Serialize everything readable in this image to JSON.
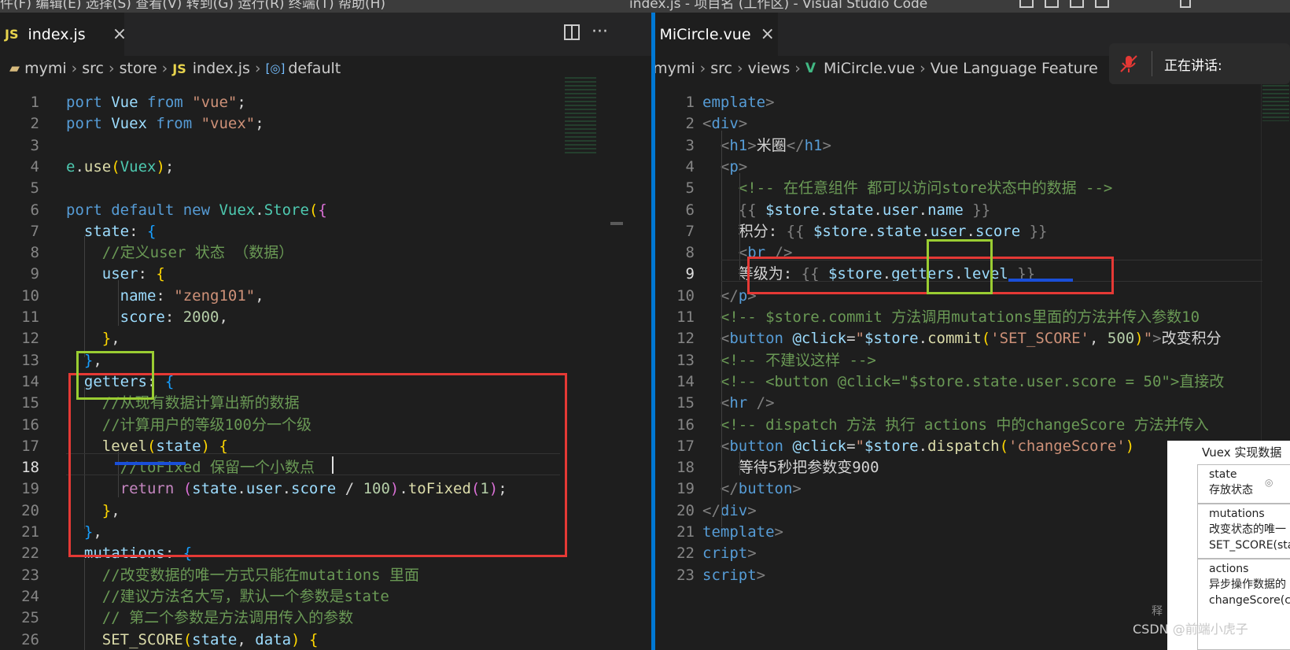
{
  "window": {
    "menu_text": "件(F)   编辑(E)   选择(S)   查看(V)   转到(G)   运行(R)   终端(T)   帮助(H)",
    "title": "index.js - 项目名 (工作区) - Visual Studio Code"
  },
  "left": {
    "tab_label": "index.js",
    "tab_icon": "JS",
    "breadcrumb": [
      "mymi",
      "src",
      "store",
      "index.js",
      "default"
    ],
    "current_line": 18,
    "lines": [
      {
        "n": 1,
        "segs": [
          [
            "kw",
            "port "
          ],
          [
            "var",
            "Vue "
          ],
          [
            "kw",
            "from "
          ],
          [
            "str",
            "\"vue\""
          ],
          [
            "txt",
            ";"
          ]
        ]
      },
      {
        "n": 2,
        "segs": [
          [
            "kw",
            "port "
          ],
          [
            "var",
            "Vuex "
          ],
          [
            "kw",
            "from "
          ],
          [
            "str",
            "\"vuex\""
          ],
          [
            "txt",
            ";"
          ]
        ]
      },
      {
        "n": 3,
        "segs": []
      },
      {
        "n": 4,
        "segs": [
          [
            "cls",
            "e"
          ],
          [
            "txt",
            "."
          ],
          [
            "fn",
            "use"
          ],
          [
            "b1",
            "("
          ],
          [
            "cls",
            "Vuex"
          ],
          [
            "b1",
            ")"
          ],
          [
            "txt",
            ";"
          ]
        ]
      },
      {
        "n": 5,
        "segs": []
      },
      {
        "n": 6,
        "segs": [
          [
            "kw",
            "port "
          ],
          [
            "kw",
            "default "
          ],
          [
            "kw",
            "new "
          ],
          [
            "cls",
            "Vuex"
          ],
          [
            "txt",
            "."
          ],
          [
            "cls",
            "Store"
          ],
          [
            "b1",
            "("
          ],
          [
            "b2",
            "{"
          ]
        ]
      },
      {
        "n": 7,
        "segs": [
          [
            "txt",
            "  "
          ],
          [
            "var",
            "state"
          ],
          [
            "txt",
            ": "
          ],
          [
            "b3",
            "{"
          ]
        ]
      },
      {
        "n": 8,
        "segs": [
          [
            "txt",
            "    "
          ],
          [
            "cmt",
            "//定义user 状态 （数据）"
          ]
        ]
      },
      {
        "n": 9,
        "segs": [
          [
            "txt",
            "    "
          ],
          [
            "var",
            "user"
          ],
          [
            "txt",
            ": "
          ],
          [
            "b1",
            "{"
          ]
        ]
      },
      {
        "n": 10,
        "segs": [
          [
            "txt",
            "      "
          ],
          [
            "var",
            "name"
          ],
          [
            "txt",
            ": "
          ],
          [
            "str",
            "\"zeng101\""
          ],
          [
            "txt",
            ","
          ]
        ]
      },
      {
        "n": 11,
        "segs": [
          [
            "txt",
            "      "
          ],
          [
            "var",
            "score"
          ],
          [
            "txt",
            ": "
          ],
          [
            "num",
            "2000"
          ],
          [
            "txt",
            ","
          ]
        ]
      },
      {
        "n": 12,
        "segs": [
          [
            "txt",
            "    "
          ],
          [
            "b1",
            "}"
          ],
          [
            "txt",
            ","
          ]
        ]
      },
      {
        "n": 13,
        "segs": [
          [
            "txt",
            "  "
          ],
          [
            "b3",
            "}"
          ],
          [
            "txt",
            ","
          ]
        ]
      },
      {
        "n": 14,
        "segs": [
          [
            "txt",
            "  "
          ],
          [
            "var",
            "getters"
          ],
          [
            "txt",
            ": "
          ],
          [
            "b3",
            "{"
          ]
        ]
      },
      {
        "n": 15,
        "segs": [
          [
            "txt",
            "    "
          ],
          [
            "cmt",
            "//从现有数据计算出新的数据"
          ]
        ]
      },
      {
        "n": 16,
        "segs": [
          [
            "txt",
            "    "
          ],
          [
            "cmt",
            "//计算用户的等级100分一个级"
          ]
        ]
      },
      {
        "n": 17,
        "segs": [
          [
            "txt",
            "    "
          ],
          [
            "fn",
            "level"
          ],
          [
            "b1",
            "("
          ],
          [
            "var",
            "state"
          ],
          [
            "b1",
            ")"
          ],
          [
            "txt",
            " "
          ],
          [
            "b1",
            "{"
          ]
        ]
      },
      {
        "n": 18,
        "segs": [
          [
            "txt",
            "      "
          ],
          [
            "cmt",
            "//toFixed 保留一个小数点"
          ]
        ]
      },
      {
        "n": 19,
        "segs": [
          [
            "txt",
            "      "
          ],
          [
            "ctl",
            "return "
          ],
          [
            "b2",
            "("
          ],
          [
            "var",
            "state"
          ],
          [
            "txt",
            "."
          ],
          [
            "var",
            "user"
          ],
          [
            "txt",
            "."
          ],
          [
            "var",
            "score"
          ],
          [
            "txt",
            " / "
          ],
          [
            "num",
            "100"
          ],
          [
            "b2",
            ")"
          ],
          [
            "txt",
            "."
          ],
          [
            "fn",
            "toFixed"
          ],
          [
            "b2",
            "("
          ],
          [
            "num",
            "1"
          ],
          [
            "b2",
            ")"
          ],
          [
            "txt",
            ";"
          ]
        ]
      },
      {
        "n": 20,
        "segs": [
          [
            "txt",
            "    "
          ],
          [
            "b1",
            "}"
          ],
          [
            "txt",
            ","
          ]
        ]
      },
      {
        "n": 21,
        "segs": [
          [
            "txt",
            "  "
          ],
          [
            "b3",
            "}"
          ],
          [
            "txt",
            ","
          ]
        ]
      },
      {
        "n": 22,
        "segs": [
          [
            "txt",
            "  "
          ],
          [
            "var",
            "mutations"
          ],
          [
            "txt",
            ": "
          ],
          [
            "b3",
            "{"
          ]
        ]
      },
      {
        "n": 23,
        "segs": [
          [
            "txt",
            "    "
          ],
          [
            "cmt",
            "//改变数据的唯一方式只能在mutations 里面"
          ]
        ]
      },
      {
        "n": 24,
        "segs": [
          [
            "txt",
            "    "
          ],
          [
            "cmt",
            "//建议方法名大写，默认一个参数是state"
          ]
        ]
      },
      {
        "n": 25,
        "segs": [
          [
            "txt",
            "    "
          ],
          [
            "cmt",
            "// 第二个参数是方法调用传入的参数"
          ]
        ]
      },
      {
        "n": 26,
        "segs": [
          [
            "txt",
            "    "
          ],
          [
            "fn",
            "SET_SCORE"
          ],
          [
            "b1",
            "("
          ],
          [
            "var",
            "state"
          ],
          [
            "txt",
            ", "
          ],
          [
            "var",
            "data"
          ],
          [
            "b1",
            ")"
          ],
          [
            "txt",
            " "
          ],
          [
            "b1",
            "{"
          ]
        ]
      }
    ]
  },
  "right": {
    "tab_label": "MiCircle.vue",
    "tab_icon": "V",
    "breadcrumb": [
      "mymi",
      "src",
      "views",
      "MiCircle.vue",
      "Vue Language Feature"
    ],
    "lines": [
      {
        "n": 1,
        "segs": [
          [
            "tag",
            "emplate"
          ],
          [
            "punc",
            ">"
          ]
        ]
      },
      {
        "n": 2,
        "segs": [
          [
            "punc",
            "<"
          ],
          [
            "tag",
            "div"
          ],
          [
            "punc",
            ">"
          ]
        ]
      },
      {
        "n": 3,
        "segs": [
          [
            "txt",
            "  "
          ],
          [
            "punc",
            "<"
          ],
          [
            "tag",
            "h1"
          ],
          [
            "punc",
            ">"
          ],
          [
            "txt",
            "米圈"
          ],
          [
            "punc",
            "</"
          ],
          [
            "tag",
            "h1"
          ],
          [
            "punc",
            ">"
          ]
        ]
      },
      {
        "n": 4,
        "segs": [
          [
            "txt",
            "  "
          ],
          [
            "punc",
            "<"
          ],
          [
            "tag",
            "p"
          ],
          [
            "punc",
            ">"
          ]
        ]
      },
      {
        "n": 5,
        "segs": [
          [
            "txt",
            "    "
          ],
          [
            "cmt",
            "<!-- 在任意组件 都可以访问store状态中的数据 -->"
          ]
        ]
      },
      {
        "n": 6,
        "segs": [
          [
            "txt",
            "    "
          ],
          [
            "punc",
            "{{ "
          ],
          [
            "var",
            "$store"
          ],
          [
            "txt",
            "."
          ],
          [
            "var",
            "state"
          ],
          [
            "txt",
            "."
          ],
          [
            "var",
            "user"
          ],
          [
            "txt",
            "."
          ],
          [
            "var",
            "name"
          ],
          [
            "punc",
            " }}"
          ]
        ]
      },
      {
        "n": 7,
        "segs": [
          [
            "txt",
            "    积分: "
          ],
          [
            "punc",
            "{{ "
          ],
          [
            "var",
            "$store"
          ],
          [
            "txt",
            "."
          ],
          [
            "var",
            "state"
          ],
          [
            "txt",
            "."
          ],
          [
            "var",
            "user"
          ],
          [
            "txt",
            "."
          ],
          [
            "var",
            "score"
          ],
          [
            "punc",
            " }}"
          ]
        ]
      },
      {
        "n": 8,
        "segs": [
          [
            "txt",
            "    "
          ],
          [
            "punc",
            "<"
          ],
          [
            "tag",
            "br"
          ],
          [
            "punc",
            " />"
          ]
        ]
      },
      {
        "n": 9,
        "segs": [
          [
            "txt",
            "    等级为: "
          ],
          [
            "punc",
            "{{ "
          ],
          [
            "var",
            "$store"
          ],
          [
            "txt",
            "."
          ],
          [
            "var",
            "getters"
          ],
          [
            "txt",
            "."
          ],
          [
            "var",
            "level"
          ],
          [
            "punc",
            " }}"
          ]
        ]
      },
      {
        "n": 10,
        "segs": [
          [
            "txt",
            "  "
          ],
          [
            "punc",
            "</"
          ],
          [
            "tag",
            "p"
          ],
          [
            "punc",
            ">"
          ]
        ]
      },
      {
        "n": 11,
        "segs": [
          [
            "txt",
            "  "
          ],
          [
            "cmt",
            "<!-- $store.commit 方法调用mutations里面的方法并传入参数10"
          ]
        ]
      },
      {
        "n": 12,
        "segs": [
          [
            "txt",
            "  "
          ],
          [
            "punc",
            "<"
          ],
          [
            "tag",
            "button"
          ],
          [
            "txt",
            " "
          ],
          [
            "var",
            "@click"
          ],
          [
            "txt",
            "="
          ],
          [
            "str",
            "\""
          ],
          [
            "var",
            "$store"
          ],
          [
            "txt",
            "."
          ],
          [
            "fn",
            "commit"
          ],
          [
            "b1",
            "("
          ],
          [
            "str",
            "'SET_SCORE'"
          ],
          [
            "txt",
            ", "
          ],
          [
            "num",
            "500"
          ],
          [
            "b1",
            ")"
          ],
          [
            "str",
            "\""
          ],
          [
            "punc",
            ">"
          ],
          [
            "txt",
            "改变积分"
          ]
        ]
      },
      {
        "n": 13,
        "segs": [
          [
            "txt",
            "  "
          ],
          [
            "cmt",
            "<!-- 不建议这样 -->"
          ]
        ]
      },
      {
        "n": 14,
        "segs": [
          [
            "txt",
            "  "
          ],
          [
            "cmt",
            "<!-- <button @click=\"$store.state.user.score = 50\">直接改"
          ]
        ]
      },
      {
        "n": 15,
        "segs": [
          [
            "txt",
            "  "
          ],
          [
            "punc",
            "<"
          ],
          [
            "tag",
            "hr"
          ],
          [
            "punc",
            " />"
          ]
        ]
      },
      {
        "n": 16,
        "segs": [
          [
            "txt",
            "  "
          ],
          [
            "cmt",
            "<!-- dispatch 方法 执行 actions 中的changeScore 方法并传入"
          ]
        ]
      },
      {
        "n": 17,
        "segs": [
          [
            "txt",
            "  "
          ],
          [
            "punc",
            "<"
          ],
          [
            "tag",
            "button"
          ],
          [
            "txt",
            " "
          ],
          [
            "var",
            "@click"
          ],
          [
            "txt",
            "="
          ],
          [
            "str",
            "\""
          ],
          [
            "var",
            "$store"
          ],
          [
            "txt",
            "."
          ],
          [
            "fn",
            "dispatch"
          ],
          [
            "b1",
            "("
          ],
          [
            "str",
            "'changeScore'"
          ],
          [
            "b1",
            ")"
          ]
        ]
      },
      {
        "n": 18,
        "segs": [
          [
            "txt",
            "    等待5秒把参数变900"
          ]
        ]
      },
      {
        "n": 19,
        "segs": [
          [
            "txt",
            "  "
          ],
          [
            "punc",
            "</"
          ],
          [
            "tag",
            "button"
          ],
          [
            "punc",
            ">"
          ]
        ]
      },
      {
        "n": 20,
        "segs": [
          [
            "punc",
            "</"
          ],
          [
            "tag",
            "div"
          ],
          [
            "punc",
            ">"
          ]
        ]
      },
      {
        "n": 21,
        "segs": [
          [
            "tag",
            "template"
          ],
          [
            "punc",
            ">"
          ]
        ]
      },
      {
        "n": 22,
        "segs": [
          [
            "tag",
            "cript"
          ],
          [
            "punc",
            ">"
          ]
        ]
      },
      {
        "n": 23,
        "segs": [
          [
            "tag",
            "script"
          ],
          [
            "punc",
            ">"
          ]
        ]
      }
    ]
  },
  "voice_popup": {
    "label": "正在讲话:"
  },
  "vuex_card": {
    "title": "Vuex 实现数据",
    "cells": [
      {
        "l1": "state",
        "l2": "存放状态",
        "l3": ""
      },
      {
        "l1": "mutations",
        "l2": "改变状态的唯一",
        "l3": "SET_SCORE(sta"
      },
      {
        "l1": "actions",
        "l2": "异步操作数据的",
        "l3": "changeScore(co"
      }
    ],
    "side_text": "释"
  },
  "watermark": "CSDN @前端小虎子",
  "colors": {
    "accent": "#0078d4",
    "highlight_red": "#e53935",
    "highlight_green": "#9acd32",
    "underline_blue": "#1a4fd8"
  }
}
